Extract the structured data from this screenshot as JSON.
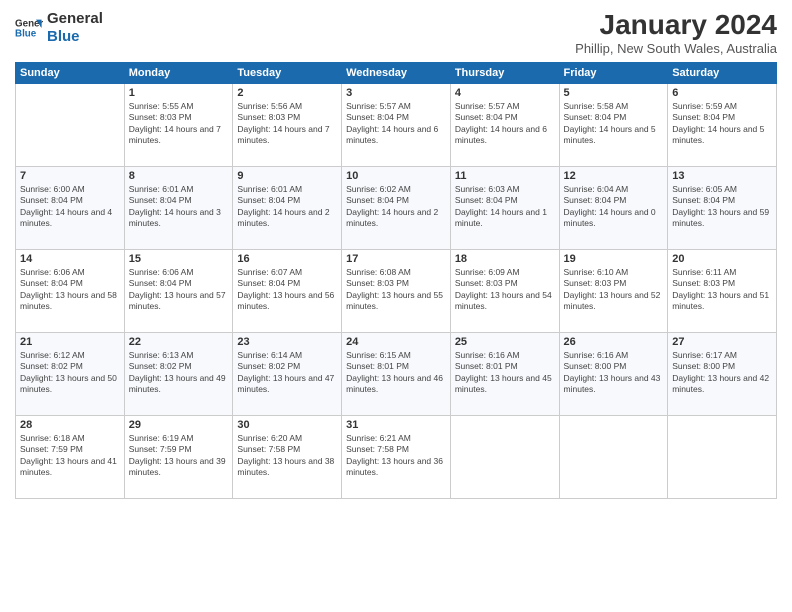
{
  "logo": {
    "general": "General",
    "blue": "Blue"
  },
  "title": "January 2024",
  "subtitle": "Phillip, New South Wales, Australia",
  "days_of_week": [
    "Sunday",
    "Monday",
    "Tuesday",
    "Wednesday",
    "Thursday",
    "Friday",
    "Saturday"
  ],
  "weeks": [
    [
      {
        "day": "",
        "sunrise": "",
        "sunset": "",
        "daylight": ""
      },
      {
        "day": "1",
        "sunrise": "Sunrise: 5:55 AM",
        "sunset": "Sunset: 8:03 PM",
        "daylight": "Daylight: 14 hours and 7 minutes."
      },
      {
        "day": "2",
        "sunrise": "Sunrise: 5:56 AM",
        "sunset": "Sunset: 8:03 PM",
        "daylight": "Daylight: 14 hours and 7 minutes."
      },
      {
        "day": "3",
        "sunrise": "Sunrise: 5:57 AM",
        "sunset": "Sunset: 8:04 PM",
        "daylight": "Daylight: 14 hours and 6 minutes."
      },
      {
        "day": "4",
        "sunrise": "Sunrise: 5:57 AM",
        "sunset": "Sunset: 8:04 PM",
        "daylight": "Daylight: 14 hours and 6 minutes."
      },
      {
        "day": "5",
        "sunrise": "Sunrise: 5:58 AM",
        "sunset": "Sunset: 8:04 PM",
        "daylight": "Daylight: 14 hours and 5 minutes."
      },
      {
        "day": "6",
        "sunrise": "Sunrise: 5:59 AM",
        "sunset": "Sunset: 8:04 PM",
        "daylight": "Daylight: 14 hours and 5 minutes."
      }
    ],
    [
      {
        "day": "7",
        "sunrise": "Sunrise: 6:00 AM",
        "sunset": "Sunset: 8:04 PM",
        "daylight": "Daylight: 14 hours and 4 minutes."
      },
      {
        "day": "8",
        "sunrise": "Sunrise: 6:01 AM",
        "sunset": "Sunset: 8:04 PM",
        "daylight": "Daylight: 14 hours and 3 minutes."
      },
      {
        "day": "9",
        "sunrise": "Sunrise: 6:01 AM",
        "sunset": "Sunset: 8:04 PM",
        "daylight": "Daylight: 14 hours and 2 minutes."
      },
      {
        "day": "10",
        "sunrise": "Sunrise: 6:02 AM",
        "sunset": "Sunset: 8:04 PM",
        "daylight": "Daylight: 14 hours and 2 minutes."
      },
      {
        "day": "11",
        "sunrise": "Sunrise: 6:03 AM",
        "sunset": "Sunset: 8:04 PM",
        "daylight": "Daylight: 14 hours and 1 minute."
      },
      {
        "day": "12",
        "sunrise": "Sunrise: 6:04 AM",
        "sunset": "Sunset: 8:04 PM",
        "daylight": "Daylight: 14 hours and 0 minutes."
      },
      {
        "day": "13",
        "sunrise": "Sunrise: 6:05 AM",
        "sunset": "Sunset: 8:04 PM",
        "daylight": "Daylight: 13 hours and 59 minutes."
      }
    ],
    [
      {
        "day": "14",
        "sunrise": "Sunrise: 6:06 AM",
        "sunset": "Sunset: 8:04 PM",
        "daylight": "Daylight: 13 hours and 58 minutes."
      },
      {
        "day": "15",
        "sunrise": "Sunrise: 6:06 AM",
        "sunset": "Sunset: 8:04 PM",
        "daylight": "Daylight: 13 hours and 57 minutes."
      },
      {
        "day": "16",
        "sunrise": "Sunrise: 6:07 AM",
        "sunset": "Sunset: 8:04 PM",
        "daylight": "Daylight: 13 hours and 56 minutes."
      },
      {
        "day": "17",
        "sunrise": "Sunrise: 6:08 AM",
        "sunset": "Sunset: 8:03 PM",
        "daylight": "Daylight: 13 hours and 55 minutes."
      },
      {
        "day": "18",
        "sunrise": "Sunrise: 6:09 AM",
        "sunset": "Sunset: 8:03 PM",
        "daylight": "Daylight: 13 hours and 54 minutes."
      },
      {
        "day": "19",
        "sunrise": "Sunrise: 6:10 AM",
        "sunset": "Sunset: 8:03 PM",
        "daylight": "Daylight: 13 hours and 52 minutes."
      },
      {
        "day": "20",
        "sunrise": "Sunrise: 6:11 AM",
        "sunset": "Sunset: 8:03 PM",
        "daylight": "Daylight: 13 hours and 51 minutes."
      }
    ],
    [
      {
        "day": "21",
        "sunrise": "Sunrise: 6:12 AM",
        "sunset": "Sunset: 8:02 PM",
        "daylight": "Daylight: 13 hours and 50 minutes."
      },
      {
        "day": "22",
        "sunrise": "Sunrise: 6:13 AM",
        "sunset": "Sunset: 8:02 PM",
        "daylight": "Daylight: 13 hours and 49 minutes."
      },
      {
        "day": "23",
        "sunrise": "Sunrise: 6:14 AM",
        "sunset": "Sunset: 8:02 PM",
        "daylight": "Daylight: 13 hours and 47 minutes."
      },
      {
        "day": "24",
        "sunrise": "Sunrise: 6:15 AM",
        "sunset": "Sunset: 8:01 PM",
        "daylight": "Daylight: 13 hours and 46 minutes."
      },
      {
        "day": "25",
        "sunrise": "Sunrise: 6:16 AM",
        "sunset": "Sunset: 8:01 PM",
        "daylight": "Daylight: 13 hours and 45 minutes."
      },
      {
        "day": "26",
        "sunrise": "Sunrise: 6:16 AM",
        "sunset": "Sunset: 8:00 PM",
        "daylight": "Daylight: 13 hours and 43 minutes."
      },
      {
        "day": "27",
        "sunrise": "Sunrise: 6:17 AM",
        "sunset": "Sunset: 8:00 PM",
        "daylight": "Daylight: 13 hours and 42 minutes."
      }
    ],
    [
      {
        "day": "28",
        "sunrise": "Sunrise: 6:18 AM",
        "sunset": "Sunset: 7:59 PM",
        "daylight": "Daylight: 13 hours and 41 minutes."
      },
      {
        "day": "29",
        "sunrise": "Sunrise: 6:19 AM",
        "sunset": "Sunset: 7:59 PM",
        "daylight": "Daylight: 13 hours and 39 minutes."
      },
      {
        "day": "30",
        "sunrise": "Sunrise: 6:20 AM",
        "sunset": "Sunset: 7:58 PM",
        "daylight": "Daylight: 13 hours and 38 minutes."
      },
      {
        "day": "31",
        "sunrise": "Sunrise: 6:21 AM",
        "sunset": "Sunset: 7:58 PM",
        "daylight": "Daylight: 13 hours and 36 minutes."
      },
      {
        "day": "",
        "sunrise": "",
        "sunset": "",
        "daylight": ""
      },
      {
        "day": "",
        "sunrise": "",
        "sunset": "",
        "daylight": ""
      },
      {
        "day": "",
        "sunrise": "",
        "sunset": "",
        "daylight": ""
      }
    ]
  ]
}
